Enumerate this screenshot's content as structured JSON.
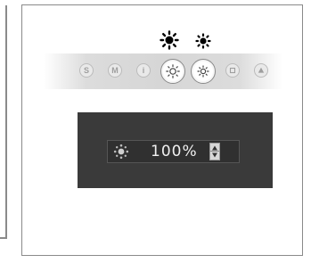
{
  "modes": [
    {
      "id": "s",
      "label": "S",
      "icon": "s-mode-icon",
      "selected": false
    },
    {
      "id": "m",
      "label": "M",
      "icon": "m-mode-icon",
      "selected": false
    },
    {
      "id": "i",
      "label": "i",
      "icon": "info-mode-icon",
      "selected": false
    },
    {
      "id": "sun-high",
      "label": "",
      "icon": "brightness-high-icon",
      "selected": true
    },
    {
      "id": "sun-low",
      "label": "",
      "icon": "brightness-low-icon",
      "selected": true
    },
    {
      "id": "square",
      "label": "",
      "icon": "square-mode-icon",
      "selected": false
    },
    {
      "id": "triangle",
      "label": "",
      "icon": "triangle-mode-icon",
      "selected": false
    }
  ],
  "control": {
    "icon": "brightness-icon",
    "value": "100%",
    "stepper_icon": "up-down-stepper-icon"
  },
  "colors": {
    "panel_background": "#ffffff",
    "frame": "#8a8a8a",
    "strip": "#d6d6d6",
    "dark_background": "#3a3a3a",
    "value_text": "#f0f0f0"
  }
}
